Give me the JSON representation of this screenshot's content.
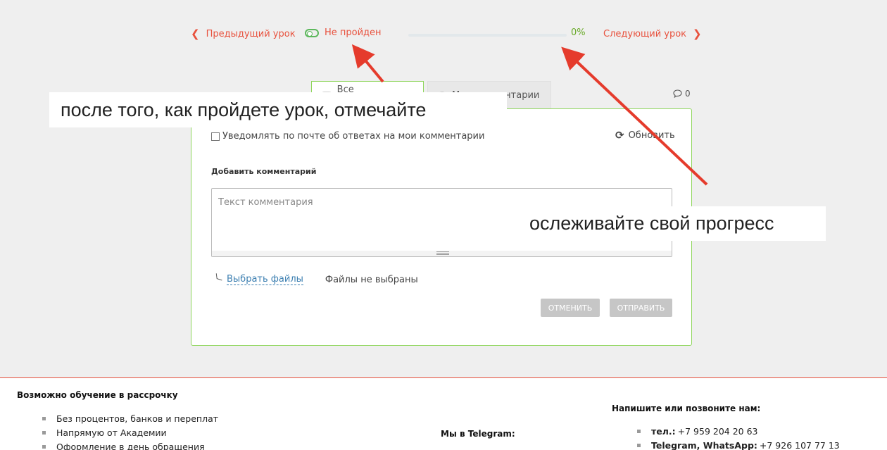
{
  "lesson_nav": {
    "prev_label": "Предыдущий урок",
    "status_label": "Не пройден",
    "progress_text": "0%",
    "progress_fraction": 0,
    "next_label": "Следующий урок"
  },
  "comments": {
    "tab_all": "Все коментарии",
    "tab_mine": "Мои комментарии",
    "count": "0",
    "notify_label": "Уведомлять по почте об ответах на мои комментарии",
    "refresh_label": "Обновить",
    "add_label": "Добавить комментарий",
    "textarea_placeholder": "Текст комментария",
    "choose_files": "Выбрать файлы",
    "no_files": "Файлы не выбраны",
    "cancel_label": "ОТМЕНИТЬ",
    "send_label": "ОТПРАВИТЬ"
  },
  "annotations": {
    "note_1": "после того, как пройдете урок, отмечайте",
    "note_2": "ослеживайте свой прогресс",
    "color": "#e53b2c"
  },
  "footer": {
    "installment_title": "Возможно обучение в рассрочку",
    "installment_items": [
      "Без процентов, банков и переплат",
      "Напрямую от Академии",
      "Оформление в день обращения"
    ],
    "telegram_title": "Мы в Telegram:",
    "contact_title": "Напишите или позвоните нам:",
    "phone_label": "тел.:",
    "phone_value": "+7 959 204 20 63",
    "messenger_label": "Telegram, WhatsApp:",
    "messenger_value": "+7 926 107 77 13"
  },
  "colors": {
    "accent": "#e8513d",
    "success": "#5cb85c",
    "panel_border": "#8fd65d",
    "link": "#3c7fb1"
  },
  "icons": [
    "chevron-left-icon",
    "toggle-icon",
    "chat-icon",
    "circle-icon",
    "speech-bubble-icon",
    "refresh-icon",
    "paperclip-icon",
    "chevron-right-icon"
  ]
}
